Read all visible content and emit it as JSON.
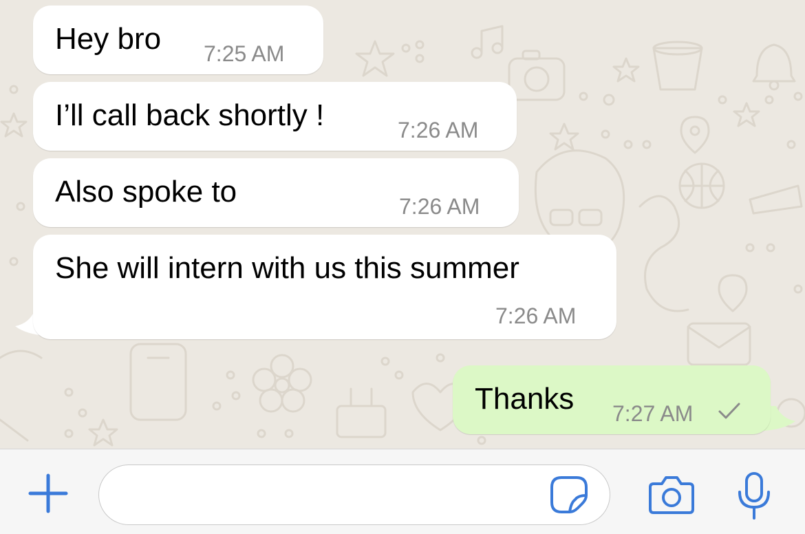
{
  "messages": [
    {
      "direction": "incoming",
      "text": "Hey bro",
      "time": "7:25 AM"
    },
    {
      "direction": "incoming",
      "text": "I’ll call back shortly !",
      "time": "7:26 AM"
    },
    {
      "direction": "incoming",
      "text": "Also spoke to",
      "time": "7:26 AM"
    },
    {
      "direction": "incoming",
      "text": "She will intern with us this summer",
      "time": "7:26 AM"
    },
    {
      "direction": "outgoing",
      "text": "Thanks",
      "time": "7:27 AM",
      "status": "sent-check"
    }
  ],
  "composer": {
    "value": "",
    "icons": [
      "plus-icon",
      "sticker-icon",
      "camera-icon",
      "microphone-icon"
    ]
  },
  "colors": {
    "incoming_bubble": "#ffffff",
    "outgoing_bubble": "#dcf8c6",
    "accent": "#3a7ad9",
    "chat_background": "#ece8e1"
  }
}
